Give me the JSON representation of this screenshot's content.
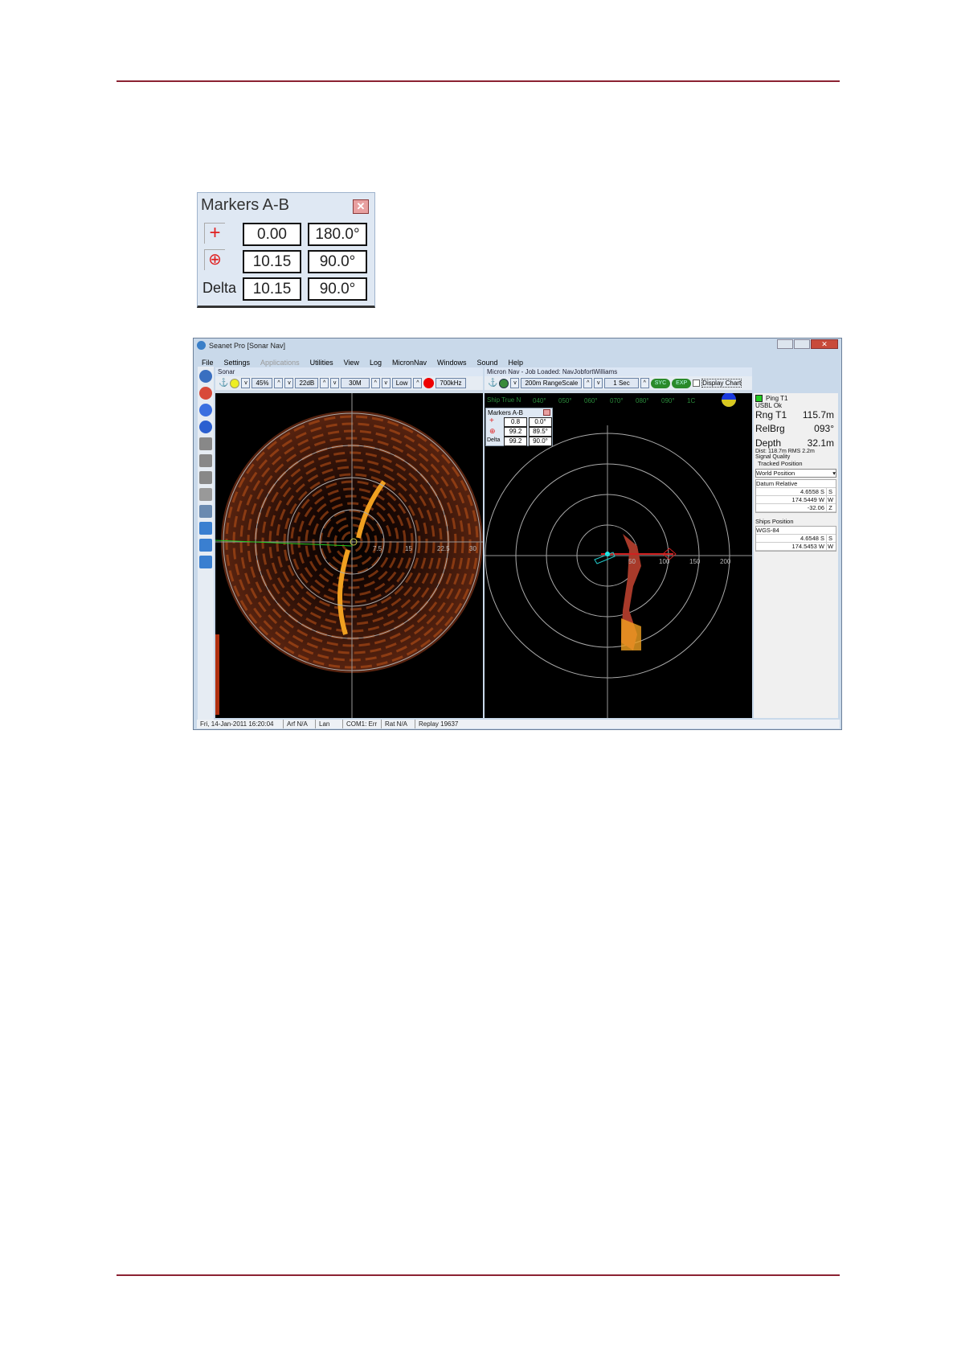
{
  "markers_dialog": {
    "title": "Markers A-B",
    "rows": [
      {
        "icon": "cross-marker-icon",
        "range": "0.00",
        "bearing": "180.0°"
      },
      {
        "icon": "crosshair-circle-marker-icon",
        "range": "10.15",
        "bearing": "90.0°"
      },
      {
        "label": "Delta",
        "range": "10.15",
        "bearing": "90.0°"
      }
    ]
  },
  "app": {
    "title": "Seanet Pro [Sonar Nav]",
    "menu": [
      "File",
      "Settings",
      "Applications",
      "Utilities",
      "View",
      "Log",
      "MicronNav",
      "Windows",
      "Sound",
      "Help"
    ],
    "sonar": {
      "title": "Sonar",
      "gain": "45%",
      "contrast": "22dB",
      "range": "30M",
      "mode": "Low",
      "frequency": "700kHz",
      "range_labels": [
        "7.5",
        "15",
        "22.5",
        "30"
      ]
    },
    "nav": {
      "title": "Micron Nav - Job Loaded: NavJobfortWilliams",
      "range_scale": "200m RangeScale",
      "interval": "1 Sec",
      "syc": "SYC",
      "exp": "EXP",
      "display_chart": "Display Chart",
      "heading_label": "Ship True N",
      "headings": [
        "040°",
        "050°",
        "060°",
        "070°",
        "080°",
        "090°",
        "1C"
      ],
      "range_labels": [
        "50",
        "100",
        "150",
        "200"
      ],
      "markers": {
        "title": "Markers A-B",
        "rows": [
          {
            "range": "0.8",
            "bearing": "0.0°"
          },
          {
            "range": "99.2",
            "bearing": "89.5°"
          },
          {
            "label": "Delta",
            "range": "99.2",
            "bearing": "90.0°"
          }
        ]
      }
    },
    "info": {
      "ping": "Ping T1",
      "usbl": "USBL Ok",
      "rng_label": "Rng T1",
      "rng": "115.7m",
      "relbrg_label": "RelBrg",
      "relbrg": "093°",
      "depth_label": "Depth",
      "depth": "32.1m",
      "dist": "Dist: 118.7m RMS 2.2m",
      "signal": "Signal Quality",
      "tracked": "Tracked Position",
      "world": "World Position",
      "datum": "Datum Relative",
      "tracked_rows": [
        [
          "4.6558 S",
          "S"
        ],
        [
          "174.5449 W",
          "W"
        ],
        [
          "-32.06",
          "Z"
        ]
      ],
      "ships": "Ships Position",
      "wgs": "WGS-84",
      "ship_rows": [
        [
          "4.6548 S",
          "S"
        ],
        [
          "174.5453 W",
          "W"
        ]
      ]
    },
    "status": [
      "Fri, 14-Jan-2011 16:20:04",
      "Arf N/A",
      "Lan",
      "COM1: Err",
      "Rat N/A",
      "Replay 19637"
    ]
  },
  "colors": {
    "rule": "#8b2232",
    "marker": "#e02020",
    "sonar_echo": "#f0a020",
    "track": "#c04020"
  }
}
